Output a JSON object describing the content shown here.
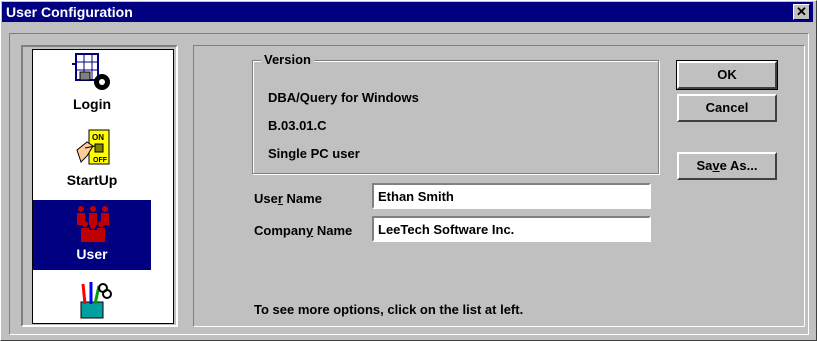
{
  "window": {
    "title": "User Configuration",
    "close_label": "✕"
  },
  "list": {
    "items": [
      {
        "label": "Login",
        "icon": "login-icon",
        "selected": false
      },
      {
        "label": "StartUp",
        "icon": "startup-icon",
        "selected": false
      },
      {
        "label": "User",
        "icon": "user-icon",
        "selected": true
      },
      {
        "label": "",
        "icon": "tools-icon",
        "selected": false
      }
    ],
    "scroll_up": "▲",
    "scroll_down": "▼"
  },
  "version": {
    "legend": "Version",
    "product": "DBA/Query for Windows",
    "number": "B.03.01.C",
    "license": "Single PC user"
  },
  "form": {
    "user_name_label_pre": "Use",
    "user_name_label_acc": "r",
    "user_name_label_post": " Name",
    "user_name_value": "Ethan Smith",
    "company_label_pre": "Compan",
    "company_label_acc": "y",
    "company_label_post": " Name",
    "company_value": "LeeTech Software Inc."
  },
  "buttons": {
    "ok": "OK",
    "cancel": "Cancel",
    "save_as_pre": "Sa",
    "save_as_acc": "v",
    "save_as_post": "e As..."
  },
  "hint": "To see more options, click on the list at left."
}
